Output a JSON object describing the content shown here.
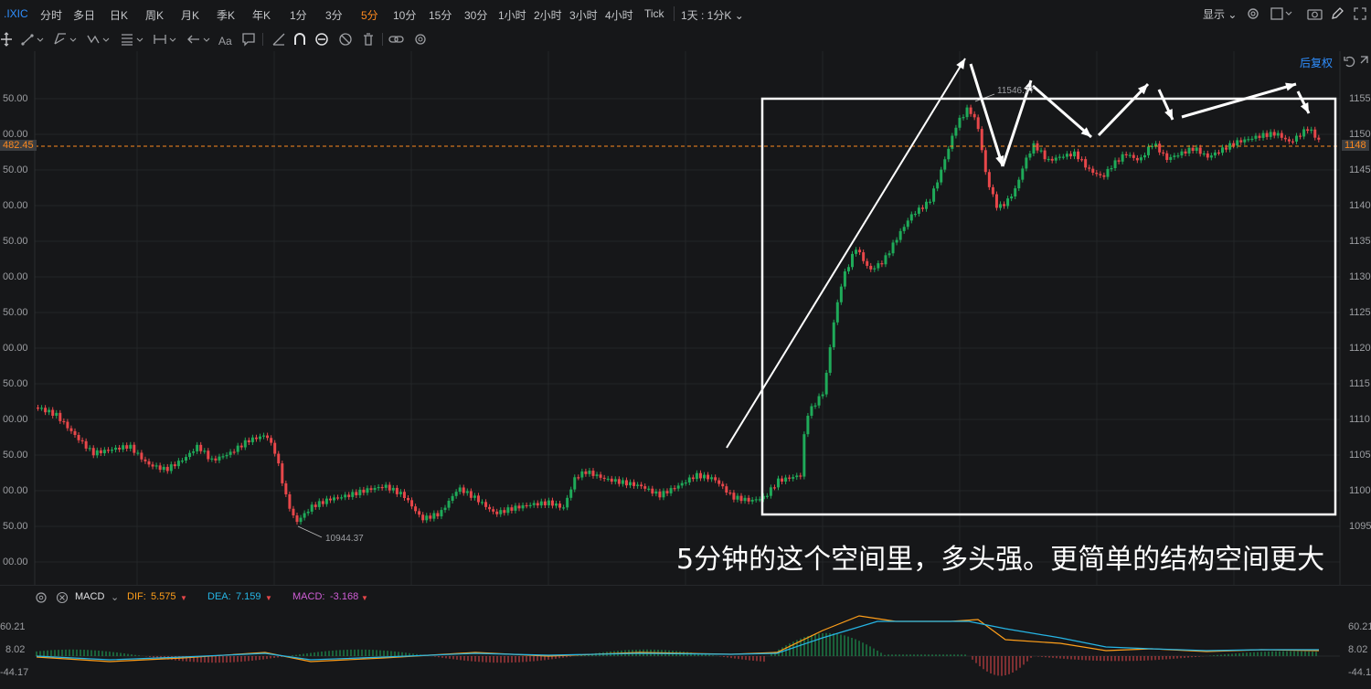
{
  "symbol": ".IXIC",
  "timeframes": [
    {
      "label": "分时",
      "active": false
    },
    {
      "label": "多日",
      "active": false
    },
    {
      "label": "日K",
      "active": false
    },
    {
      "label": "周K",
      "active": false
    },
    {
      "label": "月K",
      "active": false
    },
    {
      "label": "季K",
      "active": false
    },
    {
      "label": "年K",
      "active": false
    },
    {
      "label": "1分",
      "active": false
    },
    {
      "label": "3分",
      "active": false
    },
    {
      "label": "5分",
      "active": true
    },
    {
      "label": "10分",
      "active": false
    },
    {
      "label": "15分",
      "active": false
    },
    {
      "label": "30分",
      "active": false
    },
    {
      "label": "1小时",
      "active": false
    },
    {
      "label": "2小时",
      "active": false
    },
    {
      "label": "3小时",
      "active": false
    },
    {
      "label": "4小时",
      "active": false
    },
    {
      "label": "Tick",
      "active": false
    }
  ],
  "period_select": "1天 : 1分K",
  "display_label": "显示",
  "adjust_label": "后复权",
  "text_tool_label": "Aa",
  "price_axis_right": [
    "1155",
    "1150",
    "1145",
    "1140",
    "1135",
    "1130",
    "1125",
    "1120",
    "1115",
    "1110",
    "1105",
    "1100",
    "1095"
  ],
  "price_axis_left": [
    "50.00",
    "00.00",
    "50.00",
    "00.00",
    "50.00",
    "00.00",
    "50.00",
    "00.00",
    "50.00",
    "00.00",
    "50.00",
    "00.00",
    "50.00",
    "00.00"
  ],
  "current_price_left": "482.45",
  "current_price_right": "1148",
  "high_label": "11546.77",
  "low_label": "10944.37",
  "annotation_text": "5分钟的这个空间里，多头强。更简单的结构空间更大",
  "macd": {
    "name": "MACD",
    "dif_label": "DIF:",
    "dif_value": "5.575",
    "dea_label": "DEA:",
    "dea_value": "7.159",
    "macd_label": "MACD:",
    "macd_value": "-3.168",
    "axis": [
      "60.21",
      "8.02",
      "-44.17"
    ]
  },
  "colors": {
    "up": "#1faa59",
    "down": "#e7474a",
    "active": "#ff8a1f",
    "link": "#2f8fff",
    "dif": "#ff9f1a",
    "dea": "#26b5e5",
    "macd": "#d05ed6"
  }
}
